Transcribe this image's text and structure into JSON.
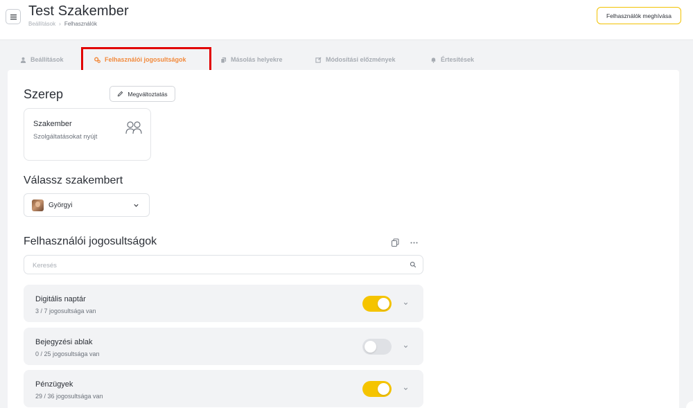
{
  "header": {
    "title": "Test Szakember",
    "breadcrumb": [
      "Beállítások",
      "Felhasználók"
    ],
    "invite_label": "Felhasználók meghívása"
  },
  "tabs": [
    {
      "label": "Beállítások",
      "icon": "user-icon",
      "active": false
    },
    {
      "label": "Felhasználói jogosultságok",
      "icon": "gears-icon",
      "active": true
    },
    {
      "label": "Másolás helyekre",
      "icon": "copy-icon",
      "active": false
    },
    {
      "label": "Módosítási előzmények",
      "icon": "edit-icon",
      "active": false
    },
    {
      "label": "Értesítések",
      "icon": "bell-icon",
      "active": false
    }
  ],
  "role_section": {
    "title": "Szerep",
    "edit_label": "Megváltoztatás",
    "role": {
      "name": "Szakember",
      "description": "Szolgáltatásokat nyújt",
      "icon": "users-icon"
    }
  },
  "expert_section": {
    "title": "Válassz szakembert",
    "selected": "Györgyi"
  },
  "permissions": {
    "title": "Felhasználói jogosultságok",
    "search_placeholder": "Keresés",
    "items": [
      {
        "name": "Digitális naptár",
        "count": "3 / 7 jogosultsága van",
        "enabled": true
      },
      {
        "name": "Bejegyzési ablak",
        "count": "0 / 25 jogosultsága van",
        "enabled": false
      },
      {
        "name": "Pénzügyek",
        "count": "29 / 36 jogosultsága van",
        "enabled": true
      }
    ]
  },
  "colors": {
    "accent_yellow": "#f5c400",
    "active_tab": "#f28a3c",
    "highlight_red": "#e10000"
  }
}
